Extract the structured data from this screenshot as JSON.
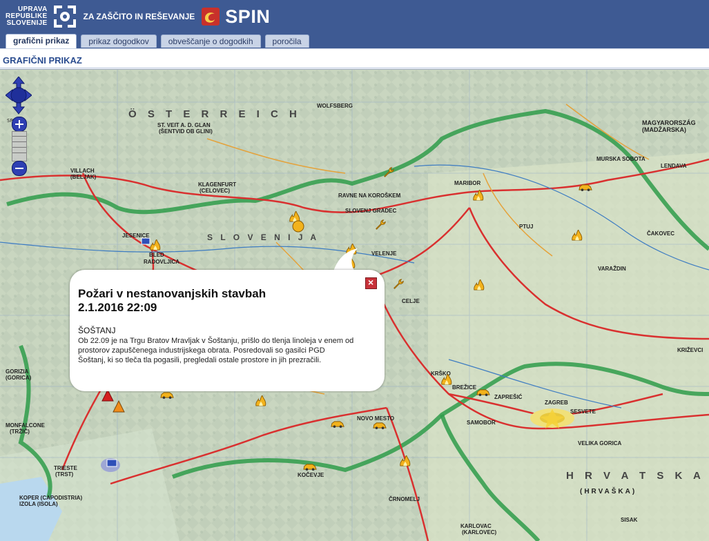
{
  "header": {
    "org_line1": "UPRAVA",
    "org_line2": "REPUBLIKE",
    "org_line3": "SLOVENIJE",
    "agency": "ZA ZAŠČITO IN REŠEVANJE",
    "app_name": "SPIN",
    "bg_color": "#3e5a93"
  },
  "tabs": [
    {
      "label": "grafični prikaz",
      "active": true
    },
    {
      "label": "prikaz dogodkov",
      "active": false
    },
    {
      "label": "obveščanje o dogodkih",
      "active": false
    },
    {
      "label": "poročila",
      "active": false
    }
  ],
  "page_title": "GRAFIČNI PRIKAZ",
  "map": {
    "region_labels": [
      "Ö S T E R R E I C H",
      "S L O V E N I J A",
      "H R V A T S K A",
      "MAGYARORSZÁG",
      "(MADŽARSKA)",
      "(HRVAŠKA)"
    ],
    "cities": [
      "VILLACH",
      "(BELJAK)",
      "KLAGENFURT",
      "(CELOVEC)",
      "MARIBOR",
      "CELJE",
      "VELENJE",
      "JESENICE",
      "BLED",
      "RADOVLJICA",
      "PTUJ",
      "ZAGREB",
      "SESVETE",
      "VARAŽDIN",
      "ČAKOVEC",
      "KRIŽEVCI",
      "SAMOBOR",
      "VELIKA GORICA",
      "KARLOVAC",
      "(KARLOVEC)",
      "TRIESTE",
      "(TRST)",
      "KOPER (CAPODISTRIA)",
      "IZOLA (ISOLA)",
      "NOVO MESTO",
      "KOČEVJE",
      "ČRNOMELJ",
      "KRŠKO",
      "BREŽICE",
      "ZAPREŠIĆ",
      "SLOVENJ GRADEC",
      "RAVNE NA KOROŠKEM",
      "WOLFSBERG",
      "ST. VEIT A. D. GLAN",
      "(ŠENTVID OB GLINI)",
      "GORIZIA",
      "(GORICA)",
      "MONFALCONE",
      "(TRŽIČ)",
      "MURSKA SOBOTA",
      "LENDAVA",
      "SISAK"
    ],
    "nav_icon": "pan-arrows-icon",
    "zoom_in_icon": "zoom-in-icon",
    "zoom_out_icon": "zoom-out-icon"
  },
  "popup": {
    "title_line1": "Požari v nestanovanjskih stavbah",
    "title_line2": "2.1.2016 22:09",
    "place": "ŠOŠTANJ",
    "body": "Ob 22.09 je na Trgu Bratov Mravljak v Šoštanju, prišlo do tlenja linoleja v enem od prostorov zapuščenega industrijskega obrata. Posredovali so gasilci PGD Šoštanj, ki so tleča tla pogasili, pregledali ostale prostore in jih prezračili.",
    "close_icon": "close-icon"
  },
  "colors": {
    "fire_icon": "#f2b21c",
    "warning_red": "#d42020",
    "warning_orange": "#f08c1a",
    "road_red": "#d9302f",
    "border_green": "#2f9c4a"
  }
}
